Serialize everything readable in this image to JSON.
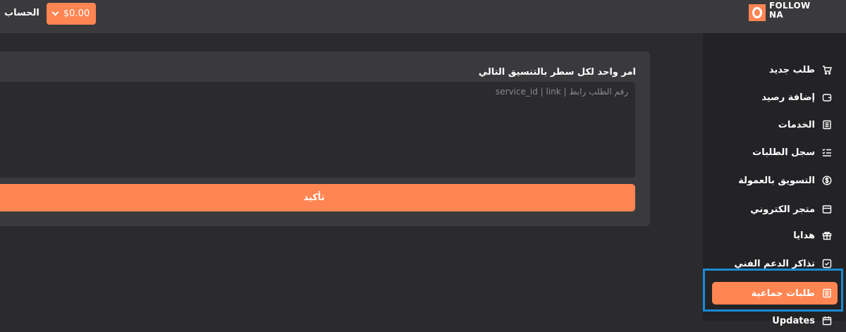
{
  "header": {
    "account_label": "الحساب",
    "balance": "$0.00",
    "logo_line1": "FOLLOW",
    "logo_line2": "NA"
  },
  "sidebar": {
    "items": [
      {
        "label": "طلب جديد",
        "icon": "cart-icon"
      },
      {
        "label": "إضافة رصيد",
        "icon": "wallet-icon"
      },
      {
        "label": "الخدمات",
        "icon": "list-icon"
      },
      {
        "label": "سجل الطلبات",
        "icon": "checklist-icon"
      },
      {
        "label": "التسويق بالعمولة",
        "icon": "dollar-coin-icon"
      },
      {
        "label": "متجر الكتروني",
        "icon": "store-icon"
      },
      {
        "label": "هدايا",
        "icon": "gift-icon"
      },
      {
        "label": "تذاكر الدعم الفني",
        "icon": "ticket-check-icon"
      },
      {
        "label": "طلبات جماعية",
        "icon": "list-icon",
        "active": true
      },
      {
        "label": "Updates",
        "icon": "calendar-icon"
      }
    ]
  },
  "main": {
    "title": "امر واحد لكل سطر بالتنسيق التالي",
    "textarea_placeholder": "service_id | link | رقم الطلب رابط",
    "submit_label": "تأكيد"
  },
  "colors": {
    "accent": "#ff8552",
    "background": "#2b2b2e",
    "topbar": "#3a3a3d",
    "sidebar": "#232326",
    "highlight": "#1a8ad4"
  }
}
